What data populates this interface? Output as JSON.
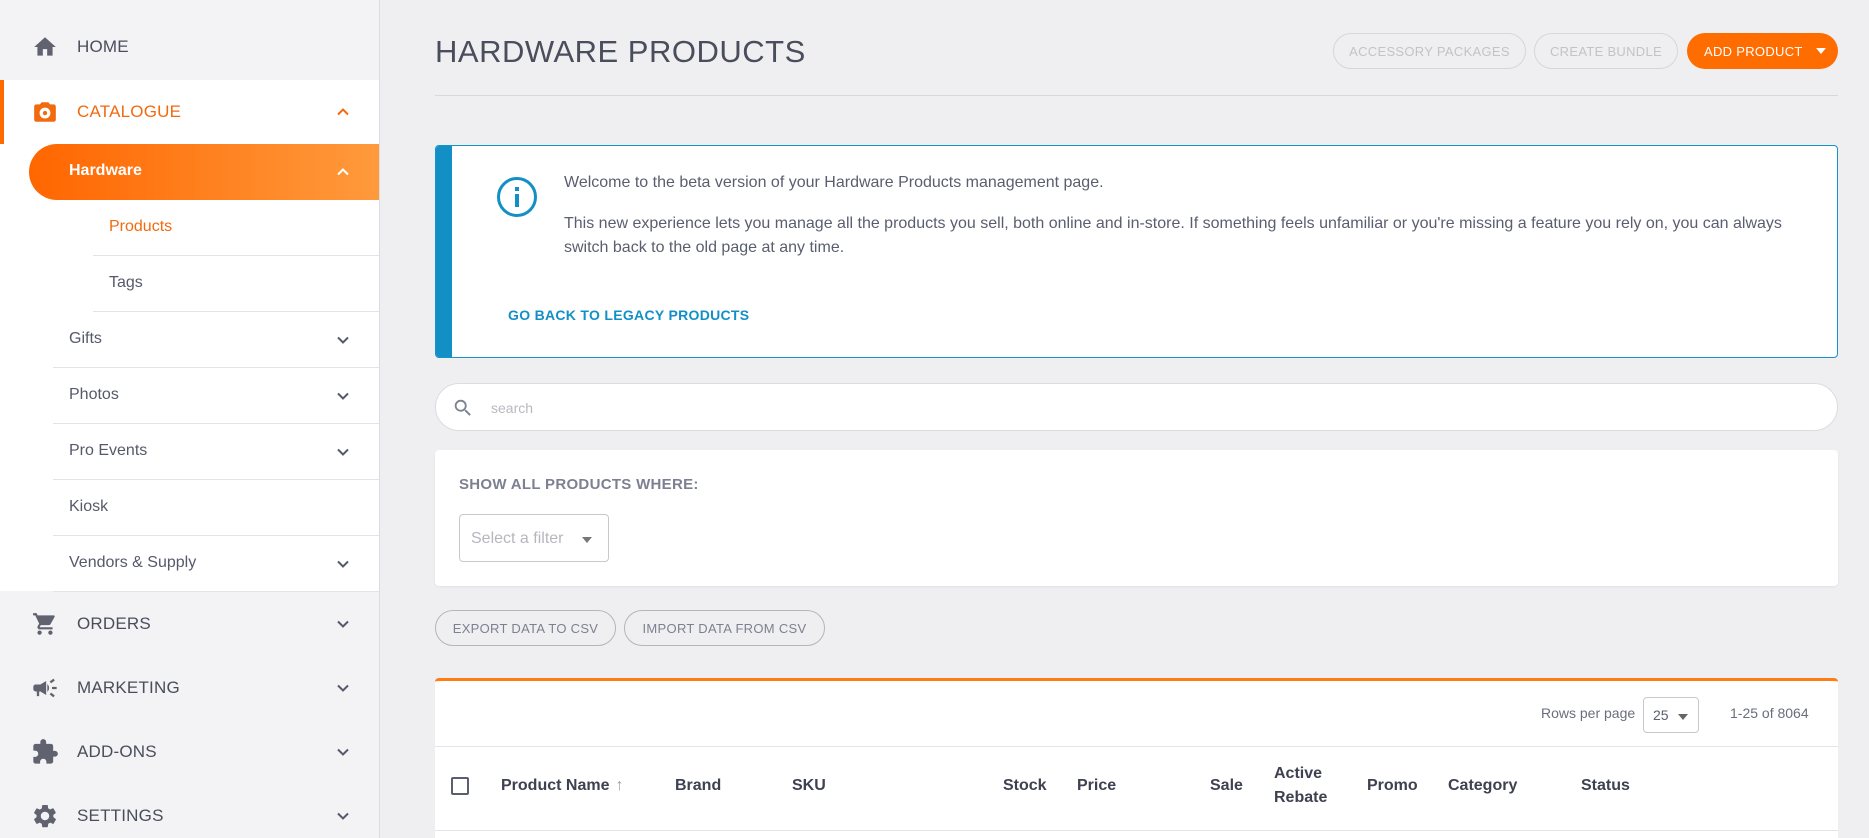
{
  "sidebar": {
    "home": "HOME",
    "catalogue": "CATALOGUE",
    "hardware": "Hardware",
    "products": "Products",
    "tags": "Tags",
    "gifts": "Gifts",
    "photos": "Photos",
    "pro_events": "Pro Events",
    "kiosk": "Kiosk",
    "vendors": "Vendors & Supply",
    "orders": "ORDERS",
    "marketing": "MARKETING",
    "addons": "ADD-ONS",
    "settings": "SETTINGS"
  },
  "header": {
    "title": "HARDWARE PRODUCTS",
    "accessory_packages": "ACCESSORY PACKAGES",
    "create_bundle": "CREATE BUNDLE",
    "add_product": "ADD PRODUCT"
  },
  "banner": {
    "line1": "Welcome to the beta version of your Hardware Products management page.",
    "line2": "This new experience lets you manage all the products you sell, both online and in-store. If something feels unfamiliar or you're missing a feature you rely on, you can always switch back to the old page at any time.",
    "legacy_link": "GO BACK TO LEGACY PRODUCTS"
  },
  "search": {
    "placeholder": "search"
  },
  "filter": {
    "label": "SHOW ALL PRODUCTS WHERE:",
    "select_placeholder": "Select a filter"
  },
  "actions": {
    "export": "EXPORT DATA TO CSV",
    "import": "IMPORT DATA FROM CSV"
  },
  "table": {
    "rows_per_page_label": "Rows per page",
    "rows_per_page": "25",
    "range": "1-25 of 8064",
    "columns": {
      "product_name": "Product Name",
      "brand": "Brand",
      "sku": "SKU",
      "stock": "Stock",
      "price": "Price",
      "sale": "Sale",
      "active_rebate_1": "Active",
      "active_rebate_2": "Rebate",
      "promo": "Promo",
      "category": "Category",
      "status": "Status"
    }
  },
  "colors": {
    "accent": "#ff6c00",
    "info": "#1290c5"
  }
}
